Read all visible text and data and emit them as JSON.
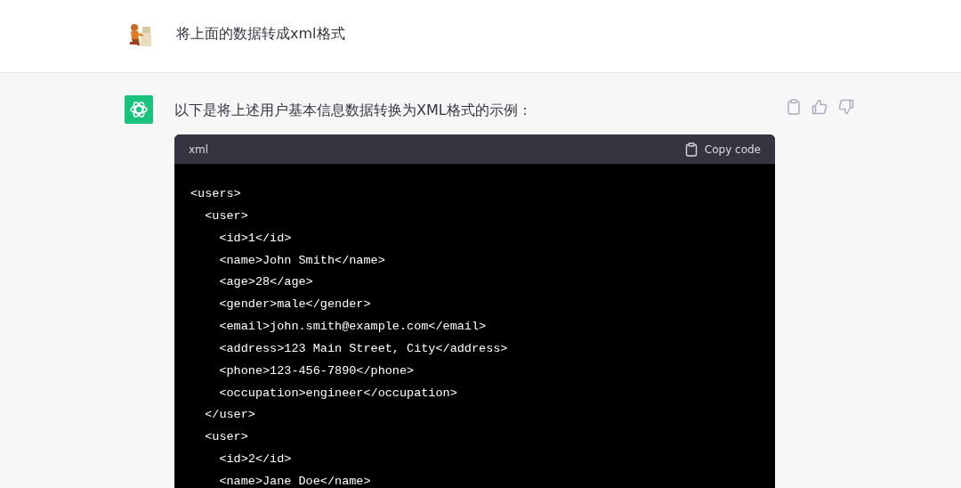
{
  "user_message": {
    "text": "将上面的数据转成xml格式"
  },
  "assistant_message": {
    "text": "以下是将上述用户基本信息数据转换为XML格式的示例：",
    "code_block": {
      "language": "xml",
      "copy_label": "Copy code",
      "lines": [
        "<users>",
        "  <user>",
        "    <id>1</id>",
        "    <name>John Smith</name>",
        "    <age>28</age>",
        "    <gender>male</gender>",
        "    <email>john.smith@example.com</email>",
        "    <address>123 Main Street, City</address>",
        "    <phone>123-456-7890</phone>",
        "    <occupation>engineer</occupation>",
        "  </user>",
        "  <user>",
        "    <id>2</id>",
        "    <name>Jane Doe</name>"
      ]
    }
  }
}
